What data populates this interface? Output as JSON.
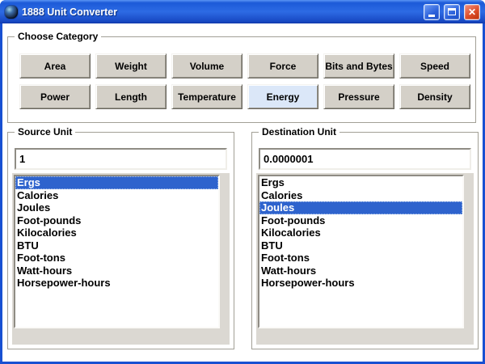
{
  "window": {
    "title": "1888 Unit Converter"
  },
  "icons": {
    "app": "converter-gear",
    "minimize": "_",
    "maximize": "□",
    "close": "✕"
  },
  "category": {
    "label": "Choose Category",
    "selected": "Energy",
    "buttons": [
      "Area",
      "Weight",
      "Volume",
      "Force",
      "Bits and Bytes",
      "Speed",
      "Power",
      "Length",
      "Temperature",
      "Energy",
      "Pressure",
      "Density"
    ]
  },
  "source": {
    "label": "Source Unit",
    "value": "1",
    "selected": "Ergs",
    "units": [
      "Ergs",
      "Calories",
      "Joules",
      "Foot-pounds",
      "Kilocalories",
      "BTU",
      "Foot-tons",
      "Watt-hours",
      "Horsepower-hours"
    ]
  },
  "destination": {
    "label": "Destination Unit",
    "value": "0.0000001",
    "selected": "Joules",
    "units": [
      "Ergs",
      "Calories",
      "Joules",
      "Foot-pounds",
      "Kilocalories",
      "BTU",
      "Foot-tons",
      "Watt-hours",
      "Horsepower-hours"
    ]
  },
  "colors": {
    "titlebar_blue": "#1c5ad8",
    "window_border_blue": "#1850d2",
    "selection_blue": "#2e63cd",
    "button_face": "#d4d0c8",
    "selected_button_face": "#dbe7f8",
    "list_backing_gray": "#dbd8d2"
  }
}
